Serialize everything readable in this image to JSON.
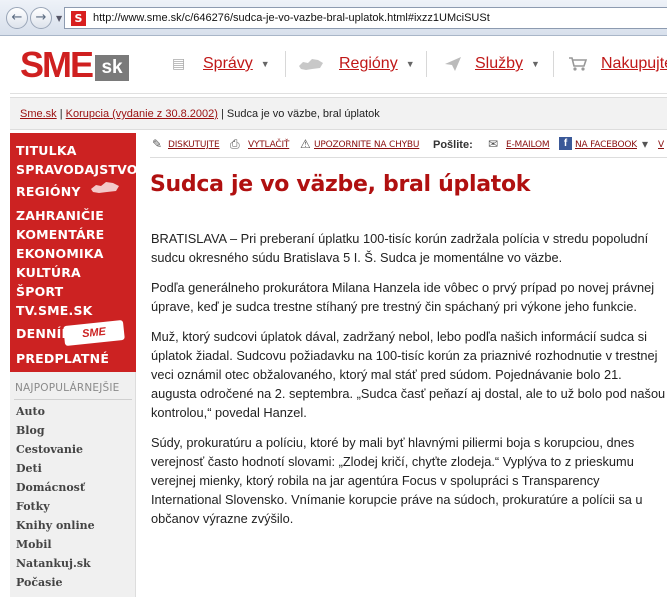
{
  "browser": {
    "url": "http://www.sme.sk/c/646276/sudca-je-vo-vazbe-bral-uplatok.html#ixzz1UMciSUSt",
    "favicon_letter": "S"
  },
  "header": {
    "logo_text": "SME",
    "logo_suffix": "sk",
    "nav": [
      {
        "label": "Správy",
        "icon": "document-icon"
      },
      {
        "label": "Regióny",
        "icon": "slovakia-map-icon"
      },
      {
        "label": "Služby",
        "icon": "paper-plane-icon"
      },
      {
        "label": "Nakupujte",
        "icon": "shopping-cart-icon"
      }
    ]
  },
  "breadcrumb": {
    "home": "Sme.sk",
    "sep1": "|",
    "section": "Korupcia (vydanie z 30.8.2002)",
    "sep2": "|",
    "current": "Sudca je vo väzbe, bral úplatok"
  },
  "sidebar": {
    "main_items": [
      "TITULKA",
      "SPRAVODAJSTVO",
      "REGIÓNY",
      "ZAHRANIČIE",
      "KOMENTÁRE",
      "EKONOMIKA",
      "KULTÚRA",
      "ŠPORT",
      "TV.SME.SK",
      "DENNÍK",
      "PREDPLATNÉ"
    ],
    "sme_badge": "SME",
    "popular_title": "NAJPOPULÁRNEJŠIE",
    "popular_items": [
      "Auto",
      "Blog",
      "Cestovanie",
      "Deti",
      "Domácnosť",
      "Fotky",
      "Knihy online",
      "Mobil",
      "Natankuj.sk",
      "Počasie"
    ]
  },
  "tools": {
    "discuss": "DISKUTUJTE",
    "print": "VYTLAČIŤ",
    "report": "UPOZORNITE NA CHYBU",
    "share_label": "Pošlite:",
    "email": "E-MAILOM",
    "facebook": "NA FACEBOOK",
    "more": "V"
  },
  "article": {
    "title": "Sudca je vo väzbe, bral úplatok",
    "paragraphs": [
      "BRATISLAVA – Pri preberaní úplatku 100-tisíc korún zadržala polícia v stredu popoludní sudcu okresného súdu Bratislava 5 I. Š. Sudca je momentálne vo väzbe.",
      "Podľa generálneho prokurátora Milana Hanzela ide vôbec o prvý prípad po novej právnej úprave, keď je sudca trestne stíhaný pre trestný čin spáchaný pri výkone jeho funkcie.",
      "Muž, ktorý sudcovi úplatok dával, zadržaný nebol, lebo podľa našich informácií sudca si úplatok žiadal. Sudcovu požiadavku na 100-tisíc korún za priaznivé rozhodnutie v trestnej veci oznámil otec obžalovaného, ktorý mal stáť pred súdom. Pojednávanie bolo 21. augusta odročené na 2. septembra. „Sudca časť peňazí aj dostal, ale to už bolo pod našou kontrolou,“ povedal Hanzel.",
      "Súdy, prokuratúru a políciu, ktoré by mali byť hlavnými piliermi boja s korupciou, dnes verejnosť často hodnotí slovami: „Zlodej kričí, chyťte zlodeja.“ Vyplýva to z prieskumu verejnej mienky, ktorý robila na jar agentúra Focus v spolupráci s Transparency International Slovensko. Vnímanie korupcie práve na súdoch, prokuratúre a polícii sa u občanov výrazne zvýšilo."
    ]
  },
  "colors": {
    "brand_red": "#cc2222",
    "title_red": "#b01010",
    "link_red": "#9a1010"
  }
}
